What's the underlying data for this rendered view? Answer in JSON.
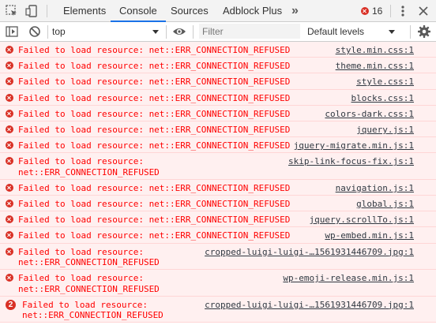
{
  "tabs": [
    {
      "label": "Elements"
    },
    {
      "label": "Console"
    },
    {
      "label": "Sources"
    },
    {
      "label": "Adblock Plus"
    }
  ],
  "more_tabs_symbol": "»",
  "error_count": "16",
  "toolbar": {
    "context": "top",
    "filter_placeholder": "Filter",
    "levels": "Default levels"
  },
  "log": [
    {
      "message": "Failed to load resource: net::ERR_CONNECTION_REFUSED",
      "source": "style.min.css:1"
    },
    {
      "message": "Failed to load resource: net::ERR_CONNECTION_REFUSED",
      "source": "theme.min.css:1"
    },
    {
      "message": "Failed to load resource: net::ERR_CONNECTION_REFUSED",
      "source": "style.css:1"
    },
    {
      "message": "Failed to load resource: net::ERR_CONNECTION_REFUSED",
      "source": "blocks.css:1"
    },
    {
      "message": "Failed to load resource: net::ERR_CONNECTION_REFUSED",
      "source": "colors-dark.css:1"
    },
    {
      "message": "Failed to load resource: net::ERR_CONNECTION_REFUSED",
      "source": "jquery.js:1"
    },
    {
      "message": "Failed to load resource: net::ERR_CONNECTION_REFUSED",
      "source": "jquery-migrate.min.js:1"
    },
    {
      "message": "Failed to load resource:\nnet::ERR_CONNECTION_REFUSED",
      "source": "skip-link-focus-fix.js:1"
    },
    {
      "message": "Failed to load resource: net::ERR_CONNECTION_REFUSED",
      "source": "navigation.js:1"
    },
    {
      "message": "Failed to load resource: net::ERR_CONNECTION_REFUSED",
      "source": "global.js:1"
    },
    {
      "message": "Failed to load resource: net::ERR_CONNECTION_REFUSED",
      "source": "jquery.scrollTo.js:1"
    },
    {
      "message": "Failed to load resource: net::ERR_CONNECTION_REFUSED",
      "source": "wp-embed.min.js:1"
    },
    {
      "message": "Failed to load resource:\nnet::ERR_CONNECTION_REFUSED",
      "source": "cropped-luigi-luigi-…1561931446709.jpg:1"
    },
    {
      "message": "Failed to load resource:\nnet::ERR_CONNECTION_REFUSED",
      "source": "wp-emoji-release.min.js:1"
    },
    {
      "message": "Failed to load resource:\nnet::ERR_CONNECTION_REFUSED",
      "source": "cropped-luigi-luigi-…1561931446709.jpg:1",
      "repeat": "2"
    }
  ]
}
